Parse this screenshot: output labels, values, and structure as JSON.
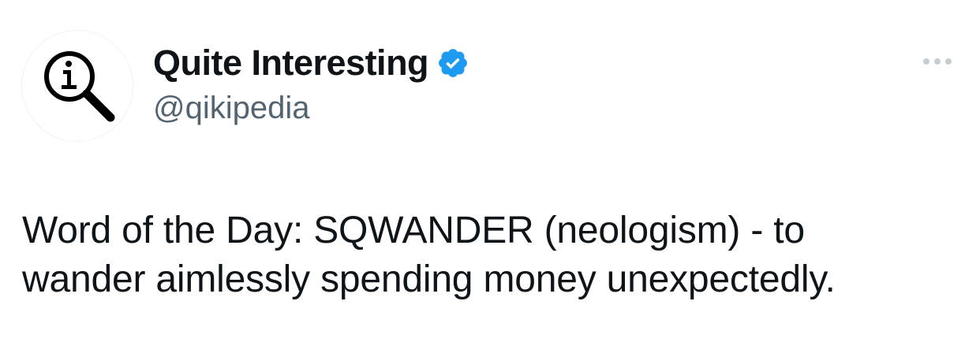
{
  "tweet": {
    "author": {
      "display_name": "Quite Interesting",
      "handle": "@qikipedia",
      "verified": true,
      "avatar_icon": "magnifying-glass-info-icon"
    },
    "more_icon": "more-options-icon",
    "body_lines": [
      "Word of the Day: SQWANDER (neologism) - to",
      "wander aimlessly spending money unexpectedly."
    ]
  },
  "colors": {
    "text": "#0f1419",
    "handle": "#536471",
    "verified_badge": "#1d9bf0",
    "more_dots": "#c4cdd3"
  }
}
